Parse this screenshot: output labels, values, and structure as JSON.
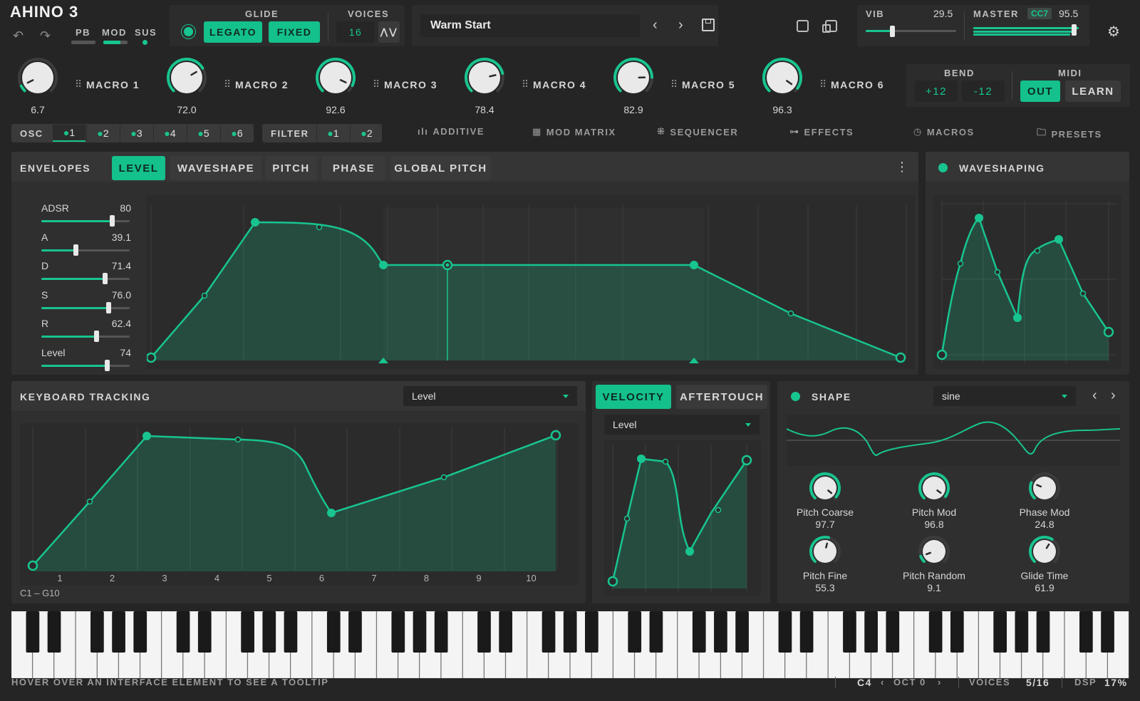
{
  "app": {
    "logo": "AHINO 3",
    "pb": "PB",
    "mod": "MOD",
    "sus": "SUS"
  },
  "glide": {
    "label": "GLIDE",
    "legato": "LEGATO",
    "fixed": "FIXED"
  },
  "voices": {
    "label": "VOICES",
    "value": "16"
  },
  "preset": {
    "name": "Warm Start"
  },
  "vib": {
    "label": "VIB",
    "value": "29.5",
    "level": 0.29
  },
  "master": {
    "label": "MASTER",
    "cc": "CC7",
    "value": "95.5",
    "level": 0.955
  },
  "macros": [
    {
      "label": "MACRO 1",
      "value": "6.7"
    },
    {
      "label": "MACRO 2",
      "value": "72.0"
    },
    {
      "label": "MACRO 3",
      "value": "92.6"
    },
    {
      "label": "MACRO 4",
      "value": "78.4"
    },
    {
      "label": "MACRO 5",
      "value": "82.9"
    },
    {
      "label": "MACRO 6",
      "value": "96.3"
    }
  ],
  "bend": {
    "label": "BEND",
    "up": "+12",
    "down": "-12"
  },
  "midi": {
    "label": "MIDI",
    "out": "OUT",
    "learn": "LEARN"
  },
  "osc": {
    "label": "OSC",
    "items": [
      "1",
      "2",
      "3",
      "4",
      "5",
      "6"
    ]
  },
  "filter": {
    "label": "FILTER",
    "items": [
      "1",
      "2"
    ]
  },
  "nav": {
    "additive": "ADDITIVE",
    "mod_matrix": "MOD MATRIX",
    "sequencer": "SEQUENCER",
    "effects": "EFFECTS",
    "macros": "MACROS",
    "presets": "PRESETS"
  },
  "envelopes": {
    "label": "ENVELOPES",
    "tabs": [
      "LEVEL",
      "WAVESHAPE",
      "PITCH",
      "PHASE",
      "GLOBAL PITCH"
    ],
    "params": [
      {
        "name": "ADSR",
        "value": "80",
        "level": 0.8
      },
      {
        "name": "A",
        "value": "39.1",
        "level": 0.39
      },
      {
        "name": "D",
        "value": "71.4",
        "level": 0.714
      },
      {
        "name": "S",
        "value": "76.0",
        "level": 0.76
      },
      {
        "name": "R",
        "value": "62.4",
        "level": 0.624
      },
      {
        "name": "Level",
        "value": "74",
        "level": 0.74
      }
    ]
  },
  "waveshaping": {
    "label": "WAVESHAPING"
  },
  "keyboard_tracking": {
    "label": "KEYBOARD TRACKING",
    "select": "Level",
    "ticks": [
      "1",
      "2",
      "3",
      "4",
      "5",
      "6",
      "7",
      "8",
      "9",
      "10"
    ],
    "range": "C1 – G10"
  },
  "velocity": {
    "tab1": "VELOCITY",
    "tab2": "AFTERTOUCH",
    "select": "Level"
  },
  "shape": {
    "label": "SHAPE",
    "select": "sine",
    "knobs": [
      {
        "name": "Pitch Coarse",
        "value": "97.7"
      },
      {
        "name": "Pitch Mod",
        "value": "96.8"
      },
      {
        "name": "Phase Mod",
        "value": "24.8"
      },
      {
        "name": "Pitch Fine",
        "value": "55.3"
      },
      {
        "name": "Pitch Random",
        "value": "9.1"
      },
      {
        "name": "Glide Time",
        "value": "61.9"
      }
    ]
  },
  "status": {
    "tooltip": "HOVER OVER AN INTERFACE ELEMENT TO SEE A TOOLTIP",
    "note": "C4",
    "oct": "OCT 0",
    "voices_label": "VOICES",
    "voices": "5/16",
    "dsp_label": "DSP",
    "dsp": "17%"
  },
  "colors": {
    "accent": "#14c08c",
    "bg": "#252525",
    "panel": "#2f2f2f"
  }
}
